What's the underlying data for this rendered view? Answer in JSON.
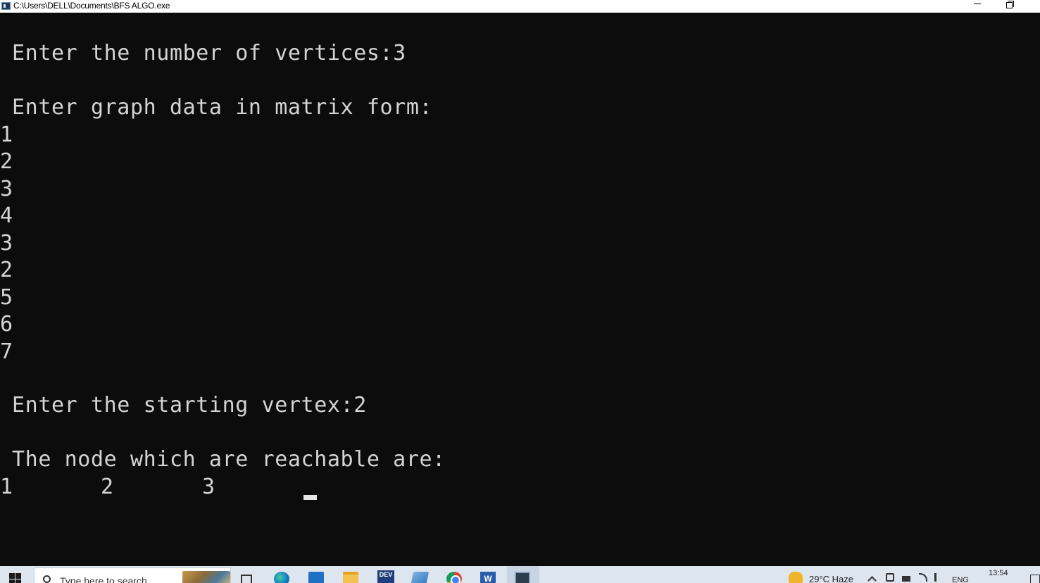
{
  "window": {
    "title": "C:\\Users\\DELL\\Documents\\BFS ALGO.exe"
  },
  "console": {
    "lines": {
      "vertices_prompt": "Enter the number of vertices:3",
      "matrix_prompt": "Enter graph data in matrix form:",
      "matrix_values": [
        "1",
        "2",
        "3",
        "4",
        "3",
        "2",
        "5",
        "6",
        "7"
      ],
      "start_prompt": "Enter the starting vertex:2",
      "reachable_prompt": "The node which are reachable are:",
      "reachable_nodes": [
        "1",
        "2",
        "3"
      ]
    }
  },
  "taskbar": {
    "search_placeholder": "Type here to search",
    "dev_label": "DEV",
    "word_label": "W",
    "weather": "29°C  Haze",
    "language": "ENG",
    "clock": "13:54"
  }
}
